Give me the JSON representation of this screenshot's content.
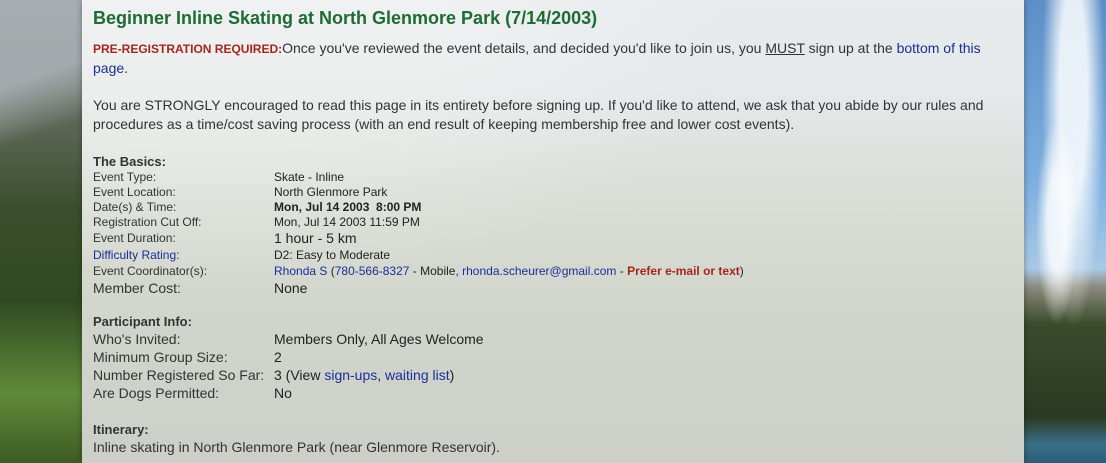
{
  "page_title": "Beginner Inline Skating at North Glenmore Park (7/14/2003)",
  "prereg": {
    "label": "PRE-REGISTRATION REQUIRED:",
    "text_before": "Once you've reviewed the event details, and decided you'd like to join us, you ",
    "must": "MUST",
    "text_middle": " sign up at the ",
    "link": "bottom of this page",
    "text_after": "."
  },
  "encourage_text": "You are STRONGLY encouraged to read this page in its entirety before signing up. If you'd like to attend, we ask that you abide by our rules and procedures as a time/cost saving process (with an end result of keeping membership free and lower cost events).",
  "basics": {
    "heading": "The Basics:",
    "event_type_label": "Event Type:",
    "event_type": "Skate - Inline",
    "location_label": "Event Location:",
    "location": "North Glenmore Park",
    "datetime_label": "Date(s) & Time:",
    "datetime": "Mon, Jul 14 2003  8:00 PM",
    "cutoff_label": "Registration Cut Off:",
    "cutoff": "Mon, Jul 14 2003 11:59 PM",
    "duration_label": "Event Duration:",
    "duration": "1 hour - 5 km",
    "difficulty_label": "Difficulty Rating:",
    "difficulty": "D2: Easy to Moderate",
    "coordinator_label": "Event Coordinator(s):",
    "coordinator_name": "Rhonda S",
    "coordinator_open": " (",
    "coordinator_phone": "780-566-8327",
    "coordinator_mobile": " - Mobile, ",
    "coordinator_email": "rhonda.scheurer@gmail.com",
    "coordinator_dash": " - ",
    "coordinator_pref": "Prefer e-mail or text",
    "coordinator_close": ")",
    "cost_label": "Member Cost:",
    "cost": "None"
  },
  "participant": {
    "heading": "Participant Info:",
    "invited_label": "Who's Invited:",
    "invited": "Members Only, All Ages Welcome",
    "min_group_label": "Minimum Group Size:",
    "min_group": "2",
    "registered_label": "Number Registered So Far:",
    "registered_count": "3 (View ",
    "signups_link": "sign-ups",
    "comma": ", ",
    "waiting_link": "waiting list",
    "close": ")",
    "dogs_label": "Are Dogs Permitted:",
    "dogs": "No"
  },
  "itinerary": {
    "heading": "Itinerary:",
    "text": "Inline skating in North Glenmore Park (near Glenmore Reservoir)."
  }
}
